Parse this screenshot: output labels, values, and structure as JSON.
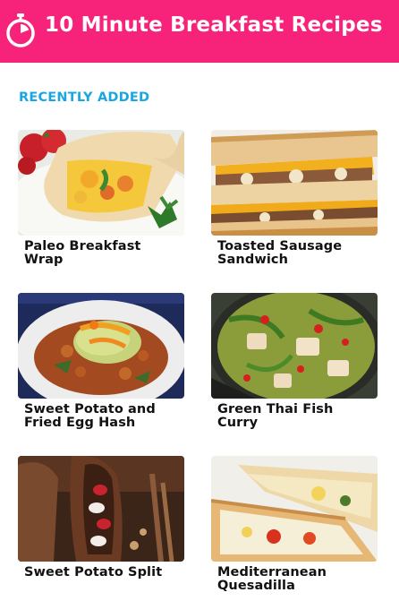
{
  "header": {
    "title": "10 Minute Breakfast Recipes",
    "icon": "stopwatch-icon",
    "background_color": "#f7227a"
  },
  "section": {
    "title": "RECENTLY ADDED",
    "color": "#1aa7e0"
  },
  "recipes": [
    {
      "title_lines": [
        "Paleo Breakfast",
        "Wrap"
      ],
      "image": "breakfast-wrap-photo"
    },
    {
      "title_lines": [
        "Toasted Sausage",
        "Sandwich"
      ],
      "image": "toasted-sandwich-photo"
    },
    {
      "title_lines": [
        "Sweet Potato and",
        "Fried Egg Hash"
      ],
      "image": "egg-hash-photo"
    },
    {
      "title_lines": [
        "Green Thai Fish",
        "Curry"
      ],
      "image": "fish-curry-photo"
    },
    {
      "title_lines": [
        "Sweet Potato Split"
      ],
      "image": "sweet-potato-split-photo"
    },
    {
      "title_lines": [
        "Mediterranean",
        "Quesadilla"
      ],
      "image": "quesadilla-photo"
    }
  ]
}
